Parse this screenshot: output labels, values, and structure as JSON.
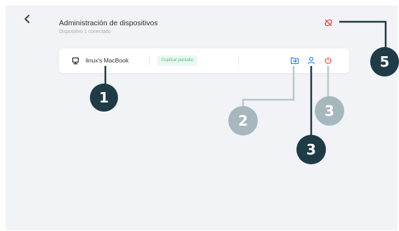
{
  "header": {
    "title": "Administración de dispositivos",
    "subtitle": "Dispositivo 1 conectado"
  },
  "device": {
    "name": "linux's MacBook",
    "mirror_label": "Duplicar pantalla"
  },
  "callouts": {
    "c1": "1",
    "c2": "2",
    "c3a": "3",
    "c3b": "3",
    "c5": "5"
  },
  "colors": {
    "background": "#f1f3f6",
    "accent_blue": "#3b82f6",
    "danger_red": "#ef4444",
    "badge_green": "#3cc78a",
    "callout_dark": "#1f3b46",
    "callout_light": "#a6b8bd"
  },
  "icons": {
    "back": "chevron-left-icon",
    "top_right": "unlink-icon",
    "device": "monitor-icon",
    "file_transfer": "folder-transfer-icon",
    "user": "user-icon",
    "power": "power-icon"
  }
}
